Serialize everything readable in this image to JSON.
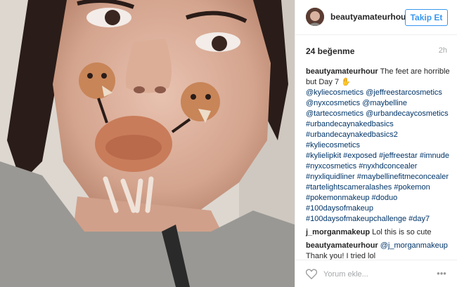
{
  "post": {
    "username": "beautyamateurhour",
    "follow_label": "Takip Et",
    "likes": "24 beğenme",
    "time": "2h",
    "avatar_icon": "user-avatar",
    "photo_icon": "selfie-photo"
  },
  "caption": {
    "username": "beautyamateurhour",
    "text": "The feet are horrible but Day 7 ✋",
    "tags": [
      "@kyliecosmetics @jeffreestarcosmetics",
      "@nyxcosmetics @maybelline",
      "@tartecosmetics @urbandecaycosmetics",
      "#urbandecaynakedbasics",
      "#urbandecaynakedbasics2 #kyliecosmetics",
      "#kylielipkit #exposed #jeffreestar #imnude",
      "#nyxcosmetics #nyxhdconcealer",
      "#nyxliquidliner #maybellinefitmeconcealer",
      "#tartelightscameralashes #pokemon",
      "#pokemonmakeup #doduo",
      "#100daysofmakeup",
      "#100daysofmakeupchallenge #day7"
    ]
  },
  "comments": [
    {
      "username": "j_morganmakeup",
      "text": "Lol this is so cute",
      "mention": ""
    },
    {
      "username": "beautyamateurhour",
      "text": "Thank you! I tried lol",
      "mention": "@j_morganmakeup"
    }
  ],
  "footer": {
    "placeholder": "Yorum ekle...",
    "more_label": "•••",
    "heart_icon": "heart-icon"
  },
  "colors": {
    "link": "#003569",
    "follow_blue": "#3897f0",
    "muted": "#a5a7aa"
  }
}
